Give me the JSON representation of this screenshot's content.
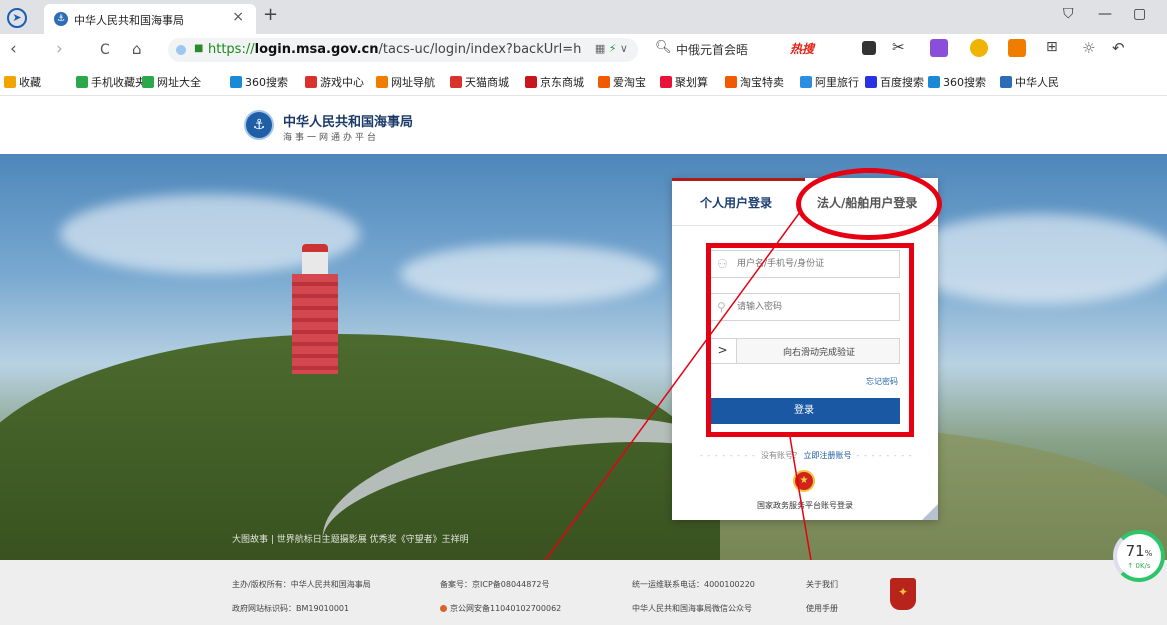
{
  "browser": {
    "tab_title": "中华人民共和国海事局",
    "tab_close": "×",
    "tab_add": "+",
    "url_protocol": "https://",
    "url_host": "login.msa.gov.cn",
    "url_path": "/tacs-uc/login/index?backUrl=h",
    "search_text": "中俄元首会晤",
    "hot_label": "热搜",
    "window_controls": [
      "⛉",
      "—",
      "▢"
    ],
    "nav_back": "‹",
    "nav_forward": "›",
    "nav_reload": "C",
    "nav_home": "⌂"
  },
  "bookmarks": [
    {
      "label": "收藏",
      "color": "#f0a500"
    },
    {
      "label": "手机收藏夹",
      "color": "#2aa84a"
    },
    {
      "label": "网址大全",
      "color": "#2aa84a"
    },
    {
      "label": "360搜索",
      "color": "#1b8ad6"
    },
    {
      "label": "游戏中心",
      "color": "#d9312b"
    },
    {
      "label": "网址导航",
      "color": "#f07d00"
    },
    {
      "label": "天猫商城",
      "color": "#d9312b"
    },
    {
      "label": "京东商城",
      "color": "#c8161d"
    },
    {
      "label": "爱淘宝",
      "color": "#f05a00"
    },
    {
      "label": "聚划算",
      "color": "#e8133b"
    },
    {
      "label": "淘宝特卖",
      "color": "#f05a00"
    },
    {
      "label": "阿里旅行",
      "color": "#2a8fe0"
    },
    {
      "label": "百度搜索",
      "color": "#2932e1"
    },
    {
      "label": "360搜索",
      "color": "#1b8ad6"
    },
    {
      "label": "中华人民",
      "color": "#2d6db5"
    }
  ],
  "header": {
    "site_name": "中华人民共和国海事局",
    "site_sub": "海事一网通办平台"
  },
  "hero": {
    "caption": "大图故事 | 世界航标日主题摄影展 优秀奖《守望者》王祥明"
  },
  "login": {
    "tab_personal": "个人用户登录",
    "tab_corporate": "法人/船舶用户登录",
    "username_placeholder": "用户名/手机号/身份证",
    "password_placeholder": "请输入密码",
    "slider_handle": ">",
    "slider_text": "向右滑动完成验证",
    "forgot_password": "忘记密码",
    "login_button": "登录",
    "no_account": "没有账号？",
    "register_link": "立即注册账号",
    "register_dashes": "- - - - - - - -",
    "gov_login": "国家政务服务平台账号登录"
  },
  "footer": {
    "sponsor": "主办/版权所有：中华人民共和国海事局",
    "icp": "备案号：京ICP备08044872号",
    "hotline": "统一运维联系电话：4000100220",
    "about": "关于我们",
    "site_id": "政府网站标识码：BM19010001",
    "police": "京公网安备11040102700062",
    "wechat": "中华人民共和国海事局微信公众号",
    "manual": "使用手册"
  },
  "speed_widget": {
    "percent": "71",
    "percent_unit": "%",
    "rate": "↑ 0K/s"
  },
  "colors": {
    "annotation": "#e60012",
    "login_button": "#1a58a4",
    "active_tab_bar": "#b01c1c"
  }
}
